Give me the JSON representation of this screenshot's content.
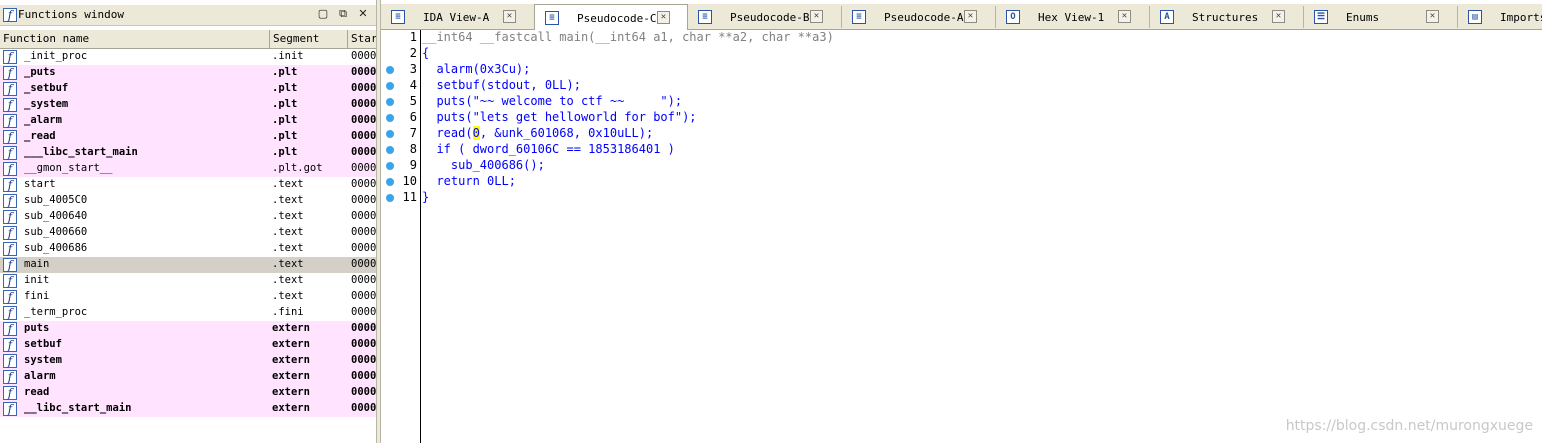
{
  "functions_window": {
    "title": "Functions window",
    "icon_glyph": "f",
    "controls": {
      "restore": "▢",
      "float": "⧉",
      "close": "✕"
    },
    "columns": [
      "Function name",
      "Segment",
      "Start"
    ],
    "rows": [
      {
        "name": "_init_proc",
        "segment": ".init",
        "start": "0000",
        "style": "normal"
      },
      {
        "name": "_puts",
        "segment": ".plt",
        "start": "0000",
        "style": "pink"
      },
      {
        "name": "_setbuf",
        "segment": ".plt",
        "start": "0000",
        "style": "pink"
      },
      {
        "name": "_system",
        "segment": ".plt",
        "start": "0000",
        "style": "pink"
      },
      {
        "name": "_alarm",
        "segment": ".plt",
        "start": "0000",
        "style": "pink"
      },
      {
        "name": "_read",
        "segment": ".plt",
        "start": "0000",
        "style": "pink"
      },
      {
        "name": "___libc_start_main",
        "segment": ".plt",
        "start": "0000",
        "style": "pink"
      },
      {
        "name": "__gmon_start__",
        "segment": ".plt.got",
        "start": "0000",
        "style": "pink-light"
      },
      {
        "name": "start",
        "segment": ".text",
        "start": "0000",
        "style": "normal"
      },
      {
        "name": "sub_4005C0",
        "segment": ".text",
        "start": "0000",
        "style": "normal"
      },
      {
        "name": "sub_400640",
        "segment": ".text",
        "start": "0000",
        "style": "normal"
      },
      {
        "name": "sub_400660",
        "segment": ".text",
        "start": "0000",
        "style": "normal"
      },
      {
        "name": "sub_400686",
        "segment": ".text",
        "start": "0000",
        "style": "normal"
      },
      {
        "name": "main",
        "segment": ".text",
        "start": "0000",
        "style": "selected"
      },
      {
        "name": "init",
        "segment": ".text",
        "start": "0000",
        "style": "normal"
      },
      {
        "name": "fini",
        "segment": ".text",
        "start": "0000",
        "style": "normal"
      },
      {
        "name": "_term_proc",
        "segment": ".fini",
        "start": "0000",
        "style": "normal"
      },
      {
        "name": "puts",
        "segment": "extern",
        "start": "0000",
        "style": "pink"
      },
      {
        "name": "setbuf",
        "segment": "extern",
        "start": "0000",
        "style": "pink"
      },
      {
        "name": "system",
        "segment": "extern",
        "start": "0000",
        "style": "pink"
      },
      {
        "name": "alarm",
        "segment": "extern",
        "start": "0000",
        "style": "pink"
      },
      {
        "name": "read",
        "segment": "extern",
        "start": "0000",
        "style": "pink"
      },
      {
        "name": "__libc_start_main",
        "segment": "extern",
        "start": "0000",
        "style": "pink"
      }
    ]
  },
  "tabs": [
    {
      "label": "IDA View-A",
      "icon": "ida-view-icon",
      "glyph": "≡",
      "active": false
    },
    {
      "label": "Pseudocode-C",
      "icon": "pseudocode-icon",
      "glyph": "≡",
      "active": true
    },
    {
      "label": "Pseudocode-B",
      "icon": "pseudocode-icon",
      "glyph": "≡",
      "active": false
    },
    {
      "label": "Pseudocode-A",
      "icon": "pseudocode-icon",
      "glyph": "≡",
      "active": false
    },
    {
      "label": "Hex View-1",
      "icon": "hex-view-icon",
      "glyph": "O",
      "active": false
    },
    {
      "label": "Structures",
      "icon": "structures-icon",
      "glyph": "A",
      "active": false
    },
    {
      "label": "Enums",
      "icon": "enums-icon",
      "glyph": "☰",
      "active": false
    },
    {
      "label": "Imports",
      "icon": "imports-icon",
      "glyph": "▤",
      "active": false
    }
  ],
  "tab_close_glyph": "✕",
  "code": [
    {
      "n": "1",
      "text": "__int64 __fastcall main(__int64 a1, char **a2, char **a3)",
      "dot": false
    },
    {
      "n": "2",
      "text": "{",
      "dot": false
    },
    {
      "n": "3",
      "text": "  alarm(0x3Cu);",
      "dot": true
    },
    {
      "n": "4",
      "text": "  setbuf(stdout, 0LL);",
      "dot": true
    },
    {
      "n": "5",
      "text": "  puts(\"~~ welcome to ctf ~~     \");",
      "dot": true
    },
    {
      "n": "6",
      "text": "  puts(\"lets get helloworld for bof\");",
      "dot": true
    },
    {
      "n": "7",
      "text_before": "  read(",
      "highlight": "0",
      "text_after": ", &unk_601068, 0x10uLL);",
      "dot": true
    },
    {
      "n": "8",
      "text": "  if ( dword_60106C == 1853186401 )",
      "dot": true
    },
    {
      "n": "9",
      "text": "    sub_400686();",
      "dot": true
    },
    {
      "n": "10",
      "text": "  return 0LL;",
      "dot": true
    },
    {
      "n": "11",
      "text": "}",
      "dot": true
    }
  ],
  "watermark": "https://blog.csdn.net/murongxuege",
  "colors": {
    "code_text": "#0000ff",
    "signature": "#808080",
    "pink_row": "#ffe3ff",
    "dot": "#3aa4e6",
    "highlight": "#ffff00"
  }
}
